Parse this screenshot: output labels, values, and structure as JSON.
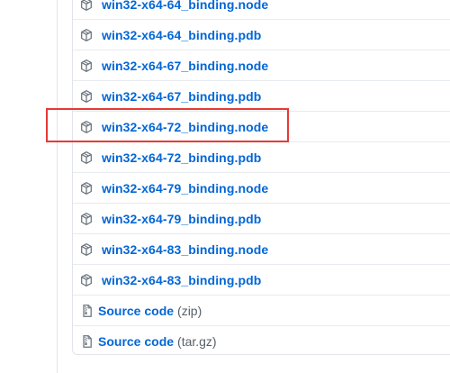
{
  "assets": [
    {
      "name": "win32-x64-64_binding.node",
      "icon": "package-icon"
    },
    {
      "name": "win32-x64-64_binding.pdb",
      "icon": "package-icon"
    },
    {
      "name": "win32-x64-67_binding.node",
      "icon": "package-icon"
    },
    {
      "name": "win32-x64-67_binding.pdb",
      "icon": "package-icon"
    },
    {
      "name": "win32-x64-72_binding.node",
      "icon": "package-icon"
    },
    {
      "name": "win32-x64-72_binding.pdb",
      "icon": "package-icon"
    },
    {
      "name": "win32-x64-79_binding.node",
      "icon": "package-icon"
    },
    {
      "name": "win32-x64-79_binding.pdb",
      "icon": "package-icon"
    },
    {
      "name": "win32-x64-83_binding.node",
      "icon": "package-icon"
    },
    {
      "name": "win32-x64-83_binding.pdb",
      "icon": "package-icon"
    }
  ],
  "source_code": [
    {
      "label": "Source code",
      "suffix": "(zip)",
      "icon": "file-zip-icon"
    },
    {
      "label": "Source code",
      "suffix": "(tar.gz)",
      "icon": "file-zip-icon"
    }
  ],
  "colors": {
    "link": "#0366d6",
    "muted": "#586069",
    "border": "#e1e4e8",
    "highlight": "#e53935"
  }
}
